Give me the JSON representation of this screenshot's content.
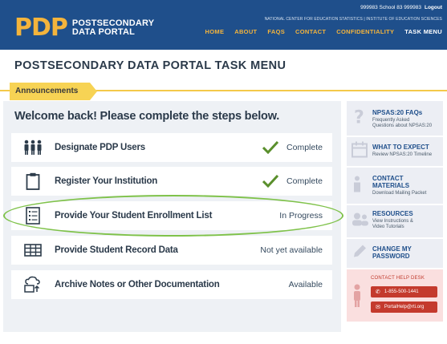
{
  "header": {
    "logo_mark": "PDP",
    "logo_line1": "POSTSECONDARY",
    "logo_line2": "DATA PORTAL",
    "user_text": "999983 School 83  999983",
    "logout": "Logout",
    "ncs_text": "NATIONAL CENTER FOR EDUCATION STATISTICS  |  INSTITUTE OF EDUCATION SCIENCES",
    "nav": [
      "HOME",
      "ABOUT",
      "FAQS",
      "CONTACT",
      "CONFIDENTIALITY",
      "TASK MENU"
    ],
    "colors": {
      "header_bg": "#1f4f8b",
      "accent": "#f4b43c"
    }
  },
  "page_title": "POSTSECONDARY DATA PORTAL TASK MENU",
  "announcements_label": "Announcements",
  "welcome": "Welcome back! Please complete the steps below.",
  "steps": [
    {
      "icon": "users-icon",
      "label": "Designate PDP Users",
      "status": "Complete",
      "check": true
    },
    {
      "icon": "clipboard-icon",
      "label": "Register Your Institution",
      "status": "Complete",
      "check": true
    },
    {
      "icon": "list-icon",
      "label": "Provide Your Student Enrollment List",
      "status": "In Progress",
      "check": false
    },
    {
      "icon": "table-icon",
      "label": "Provide Student Record Data",
      "status": "Not yet available",
      "check": false
    },
    {
      "icon": "cloud-upload-icon",
      "label": "Archive Notes or Other Documentation",
      "status": "Available",
      "check": false
    }
  ],
  "sidebar": [
    {
      "icon": "question-icon",
      "title": "NPSAS:20 FAQs",
      "sub": [
        "Frequently Asked",
        "Questions about NPSAS:20"
      ]
    },
    {
      "icon": "calendar-icon",
      "title": "WHAT TO EXPECT",
      "sub": [
        "Review NPSAS:20 Timeline"
      ]
    },
    {
      "icon": "contact-icon",
      "title": [
        "CONTACT",
        "MATERIALS"
      ],
      "sub": [
        "Download Mailing Packet"
      ]
    },
    {
      "icon": "resources-icon",
      "title": "RESOURCES",
      "sub": [
        "View Instructions &",
        "Video Tutorials"
      ]
    },
    {
      "icon": "pencil-icon",
      "title": [
        "CHANGE MY",
        "PASSWORD"
      ],
      "sub": []
    }
  ],
  "help": {
    "title": "CONTACT HELP DESK",
    "phone": "1-855-500-1441",
    "email": "PortalHelp@rti.org"
  }
}
